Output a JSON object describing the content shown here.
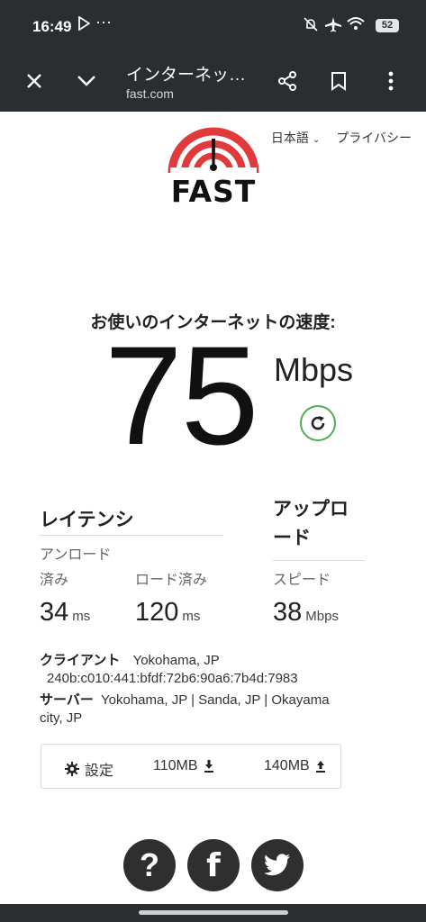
{
  "status_bar": {
    "time": "16:49",
    "extra": "···",
    "battery": "52"
  },
  "browser": {
    "tab_title": "インターネッ…",
    "url": "fast.com"
  },
  "header": {
    "language": "日本語",
    "privacy": "プライバシー"
  },
  "logo": {
    "text": "FAST",
    "accent_color": "#e03a3a"
  },
  "speed": {
    "caption": "お使いのインターネットの速度:",
    "value": "75",
    "units": "Mbps"
  },
  "latency": {
    "title": "レイテンシ",
    "unloaded_label_line1": "アンロード",
    "unloaded_label_line2": "済み",
    "unloaded_value": "34",
    "unloaded_unit": "ms",
    "loaded_label": "ロード済み",
    "loaded_value": "120",
    "loaded_unit": "ms"
  },
  "upload": {
    "title_line1": "アップロ",
    "title_line2": "ード",
    "speed_label": "スピード",
    "value": "38",
    "unit": "Mbps"
  },
  "client": {
    "label": "クライアント",
    "location": "Yokohama, JP",
    "ip": "240b:c010:441:bfdf:72b6:90a6:7b4d:7983"
  },
  "server": {
    "label": "サーバー",
    "locations_line1": "Yokohama, JP | Sanda, JP | Okayama",
    "locations_line2": "city, JP"
  },
  "settings_bar": {
    "settings_label": "設定",
    "download_size": "110MB",
    "upload_size": "140MB"
  },
  "colors": {
    "chrome_bg": "#2b2e30",
    "reload_green": "#4caf50"
  }
}
